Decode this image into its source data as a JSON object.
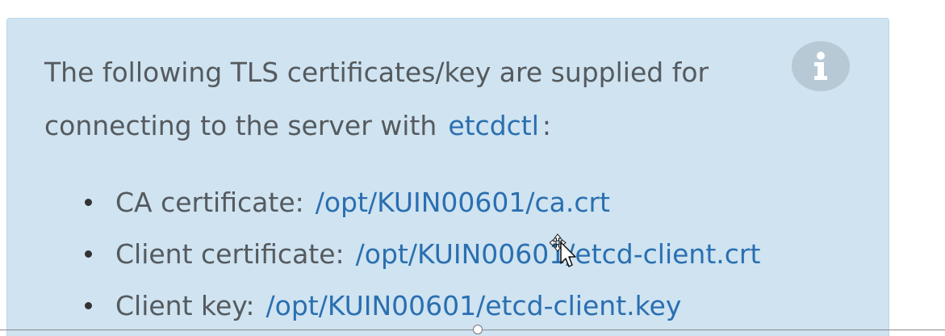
{
  "info": {
    "intro_text": "The following TLS certificates/key are supplied for connecting to the server with",
    "command": "etcdctl",
    "intro_suffix": ":",
    "icon": "info-icon",
    "items": [
      {
        "label": "CA certificate:",
        "path": "/opt/KUIN00601/ca.crt"
      },
      {
        "label": "Client certificate:",
        "path": "/opt/KUIN00601/etcd-client.crt"
      },
      {
        "label": "Client key:",
        "path": "/opt/KUIN00601/etcd-client.key"
      }
    ]
  },
  "colors": {
    "box_background": "#cfe3f1",
    "text": "#555a5e",
    "link": "#2a6fb0",
    "icon_background": "#b7c9d5"
  }
}
